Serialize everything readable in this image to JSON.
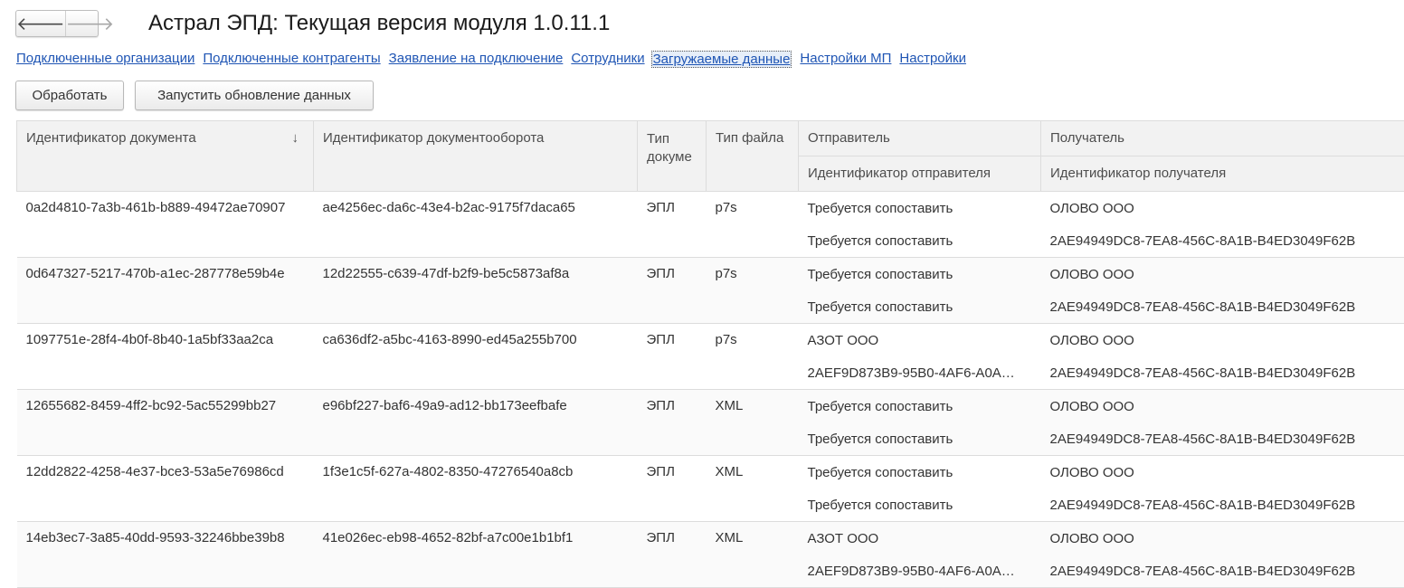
{
  "window": {
    "title": "Астрал ЭПД: Текущая версия модуля 1.0.11.1"
  },
  "nav": {
    "back_icon": "arrow-left-icon",
    "forward_icon": "arrow-right-icon"
  },
  "links": [
    "Подключенные организации",
    "Подключенные контрагенты",
    "Заявление на подключение",
    "Сотрудники",
    "Загружаемые данные",
    "Настройки МП",
    "Настройки"
  ],
  "toolbar": {
    "process_label": "Обработать",
    "update_label": "Запустить обновление данных"
  },
  "table": {
    "headers": {
      "doc_id": "Идентификатор документа",
      "flow_id": "Идентификатор документооборота",
      "doc_type": "Тип докуме",
      "file_type": "Тип файла",
      "sender": "Отправитель",
      "sender_id": "Идентификатор отправителя",
      "receiver": "Получатель",
      "receiver_id": "Идентификатор получателя"
    },
    "sort_indicator": "↓",
    "rows": [
      {
        "doc_id": "0a2d4810-7a3b-461b-b889-49472ae70907",
        "flow_id": "ae4256ec-da6c-43e4-b2ac-9175f7daca65",
        "doc_type": "ЭПЛ",
        "file_type": "p7s",
        "sender": "Требуется сопоставить",
        "sender_id": "Требуется сопоставить",
        "receiver": "ОЛОВО ООО",
        "receiver_id": "2AE94949DC8-7EA8-456C-8A1B-B4ED3049F62B"
      },
      {
        "doc_id": "0d647327-5217-470b-a1ec-287778e59b4e",
        "flow_id": "12d22555-c639-47df-b2f9-be5c5873af8a",
        "doc_type": "ЭПЛ",
        "file_type": "p7s",
        "sender": "Требуется сопоставить",
        "sender_id": "Требуется сопоставить",
        "receiver": "ОЛОВО ООО",
        "receiver_id": "2AE94949DC8-7EA8-456C-8A1B-B4ED3049F62B"
      },
      {
        "doc_id": "1097751e-28f4-4b0f-8b40-1a5bf33aa2ca",
        "flow_id": "ca636df2-a5bc-4163-8990-ed45a255b700",
        "doc_type": "ЭПЛ",
        "file_type": "p7s",
        "sender": "АЗОТ ООО",
        "sender_id": "2AEF9D873B9-95B0-4AF6-A0A…",
        "receiver": "ОЛОВО ООО",
        "receiver_id": "2AE94949DC8-7EA8-456C-8A1B-B4ED3049F62B"
      },
      {
        "doc_id": "12655682-8459-4ff2-bc92-5ac55299bb27",
        "flow_id": "e96bf227-baf6-49a9-ad12-bb173eefbafe",
        "doc_type": "ЭПЛ",
        "file_type": "XML",
        "sender": "Требуется сопоставить",
        "sender_id": "Требуется сопоставить",
        "receiver": "ОЛОВО ООО",
        "receiver_id": "2AE94949DC8-7EA8-456C-8A1B-B4ED3049F62B"
      },
      {
        "doc_id": "12dd2822-4258-4e37-bce3-53a5e76986cd",
        "flow_id": "1f3e1c5f-627a-4802-8350-47276540a8cb",
        "doc_type": "ЭПЛ",
        "file_type": "XML",
        "sender": "Требуется сопоставить",
        "sender_id": "Требуется сопоставить",
        "receiver": "ОЛОВО ООО",
        "receiver_id": "2AE94949DC8-7EA8-456C-8A1B-B4ED3049F62B"
      },
      {
        "doc_id": "14eb3ec7-3a85-40dd-9593-32246bbe39b8",
        "flow_id": "41e026ec-eb98-4652-82bf-a7c00e1b1bf1",
        "doc_type": "ЭПЛ",
        "file_type": "XML",
        "sender": "АЗОТ ООО",
        "sender_id": "2AEF9D873B9-95B0-4AF6-A0A…",
        "receiver": "ОЛОВО ООО",
        "receiver_id": "2AE94949DC8-7EA8-456C-8A1B-B4ED3049F62B"
      }
    ]
  },
  "colors": {
    "link": "#1f55b4",
    "warning": "#e8231c",
    "header_bg": "#f2f2f2"
  }
}
